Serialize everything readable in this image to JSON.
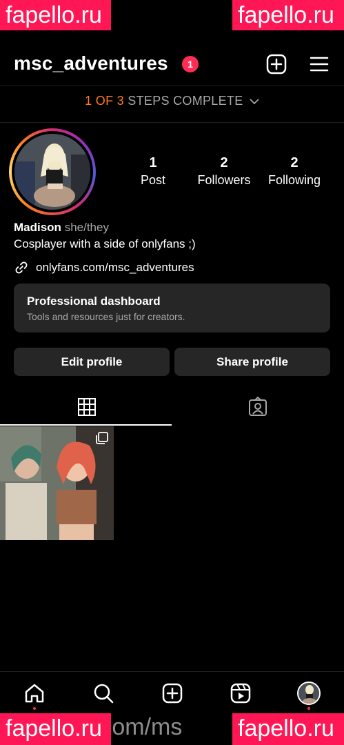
{
  "watermarks": {
    "top_left": "fapello.ru",
    "top_right": "fapello.ru",
    "bottom_left": "fapello.ru",
    "bottom_right": "fapello.ru",
    "bottom_mid": "us.com/ms"
  },
  "header": {
    "username": "msc_adventures",
    "notification_count": "1"
  },
  "steps": {
    "highlight": "1 OF 3",
    "rest": " STEPS COMPLETE"
  },
  "stats": [
    {
      "num": "1",
      "label": "Post"
    },
    {
      "num": "2",
      "label": "Followers"
    },
    {
      "num": "2",
      "label": "Following"
    }
  ],
  "profile": {
    "name": "Madison",
    "pronouns": "she/they",
    "bio": "Cosplayer with a side of onlyfans ;)",
    "link": "onlyfans.com/msc_adventures"
  },
  "dashboard": {
    "title": "Professional dashboard",
    "subtitle": "Tools and resources just for creators."
  },
  "buttons": {
    "edit": "Edit profile",
    "share": "Share profile"
  },
  "colors": {
    "accent": "#ff7a1a",
    "badge": "#ff2d55",
    "surface": "#262626"
  }
}
